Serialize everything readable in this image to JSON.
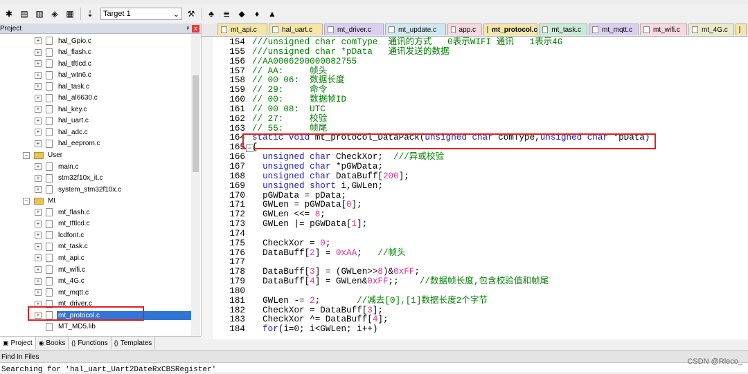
{
  "toolbar": {
    "target_value": "Target 1",
    "icons": [
      "compile-icon",
      "build-icon",
      "rebuild-icon",
      "batch-build-icon",
      "stop-build-icon",
      "load-icon",
      "target-select",
      "options-icon",
      "manage-components-icon",
      "run-time-env-icon",
      "pack-installer-icon",
      "select-packs-icon"
    ]
  },
  "project": {
    "title": "Project",
    "pin": "ᵖ",
    "close": "x",
    "tree": [
      {
        "label": "hal_Gpio.c",
        "type": "file",
        "expander": "+",
        "indent": 1
      },
      {
        "label": "hal_flash.c",
        "type": "file",
        "expander": "+",
        "indent": 1
      },
      {
        "label": "hal_tftlcd.c",
        "type": "file",
        "expander": "+",
        "indent": 1
      },
      {
        "label": "hal_wtn6.c",
        "type": "file",
        "expander": "+",
        "indent": 1
      },
      {
        "label": "hal_task.c",
        "type": "file",
        "expander": "+",
        "indent": 1
      },
      {
        "label": "hal_al6630.c",
        "type": "file",
        "expander": "+",
        "indent": 1
      },
      {
        "label": "hal_key.c",
        "type": "file",
        "expander": "+",
        "indent": 1
      },
      {
        "label": "hal_uart.c",
        "type": "file",
        "expander": "+",
        "indent": 1
      },
      {
        "label": "hal_adc.c",
        "type": "file",
        "expander": "+",
        "indent": 1
      },
      {
        "label": "hal_eeprom.c",
        "type": "file",
        "expander": "+",
        "indent": 1
      },
      {
        "label": "User",
        "type": "folder",
        "expander": "−",
        "indent": 0
      },
      {
        "label": "main.c",
        "type": "file",
        "expander": "+",
        "indent": 1
      },
      {
        "label": "stm32f10x_it.c",
        "type": "file",
        "expander": "+",
        "indent": 1
      },
      {
        "label": "system_stm32f10x.c",
        "type": "file",
        "expander": "+",
        "indent": 1
      },
      {
        "label": "Mt",
        "type": "folder",
        "expander": "−",
        "indent": 0
      },
      {
        "label": "mt_flash.c",
        "type": "file",
        "expander": "+",
        "indent": 1
      },
      {
        "label": "mt_tftlcd.c",
        "type": "file",
        "expander": "+",
        "indent": 1
      },
      {
        "label": "lcdfont.c",
        "type": "file",
        "expander": "+",
        "indent": 1
      },
      {
        "label": "mt_task.c",
        "type": "file",
        "expander": "+",
        "indent": 1
      },
      {
        "label": "mt_api.c",
        "type": "file",
        "expander": "+",
        "indent": 1
      },
      {
        "label": "mt_wifi.c",
        "type": "file",
        "expander": "+",
        "indent": 1
      },
      {
        "label": "mt_4G.c",
        "type": "file",
        "expander": "+",
        "indent": 1
      },
      {
        "label": "mt_mqtt.c",
        "type": "file",
        "expander": "+",
        "indent": 1
      },
      {
        "label": "mt_driver.c",
        "type": "file",
        "expander": "+",
        "indent": 1
      },
      {
        "label": "mt_protocol.c",
        "type": "file",
        "expander": "+",
        "indent": 1,
        "selected": true
      },
      {
        "label": "MT_MD5.lib",
        "type": "file",
        "expander": "",
        "indent": 1
      }
    ],
    "tabs": [
      {
        "label": "Project",
        "icon": "project-tab-icon"
      },
      {
        "label": "Books",
        "icon": "books-tab-icon"
      },
      {
        "label": "Functions",
        "icon": "functions-tab-icon"
      },
      {
        "label": "Templates",
        "icon": "templates-tab-icon"
      }
    ]
  },
  "editor": {
    "tabs": [
      {
        "label": "mt_api.c",
        "color": "#f5e6a8"
      },
      {
        "label": "hal_uart.c",
        "color": "#f5e6a8"
      },
      {
        "label": "mt_driver.c",
        "color": "#d8d0f0"
      },
      {
        "label": "mt_update.c",
        "color": "#d0e8f0"
      },
      {
        "label": "app.c",
        "color": "#f8d8e0"
      },
      {
        "label": "mt_protocol.c",
        "color": "#f5e6a8",
        "active": true
      },
      {
        "label": "mt_task.c",
        "color": "#c8ead8"
      },
      {
        "label": "mt_mqtt.c",
        "color": "#d8d0f0"
      },
      {
        "label": "mt_wifi.c",
        "color": "#f8d8e0"
      },
      {
        "label": "mt_4G.c",
        "color": "#e8ecc8"
      },
      {
        "label": "",
        "color": "#f5e6a8"
      }
    ],
    "lines": [
      {
        "n": "154",
        "code": "///unsigned char comType  通讯的方式   0表示WIFI 通讯   1表示4G"
      },
      {
        "n": "155",
        "code": "///unsigned char *pData   通讯发送的数据"
      },
      {
        "n": "156",
        "code": "//AA0006290000082755"
      },
      {
        "n": "157",
        "code": "// AA:     帧头"
      },
      {
        "n": "158",
        "code": "// 00 06:  数据长度"
      },
      {
        "n": "159",
        "code": "// 29:     命令"
      },
      {
        "n": "160",
        "code": "// 00:     数据帧ID"
      },
      {
        "n": "161",
        "code": "// 00 08:  UTC"
      },
      {
        "n": "162",
        "code": "// 27:     校验"
      },
      {
        "n": "163",
        "code": "// 55:     帧尾"
      },
      {
        "n": "164",
        "code": "static void mt_protocol_DataPack(unsigned char comType,unsigned char *pData)"
      },
      {
        "n": "165",
        "code": "{"
      },
      {
        "n": "166",
        "code": "  unsigned char CheckXor;  ///异或校验"
      },
      {
        "n": "167",
        "code": "  unsigned char *pGWData;"
      },
      {
        "n": "168",
        "code": "  unsigned char DataBuff[200];"
      },
      {
        "n": "169",
        "code": "  unsigned short i,GWLen;"
      },
      {
        "n": "170",
        "code": "  pGWData = pData;"
      },
      {
        "n": "171",
        "code": "  GWLen = pGWData[0];"
      },
      {
        "n": "172",
        "code": "  GWLen <<= 8;"
      },
      {
        "n": "173",
        "code": "  GWLen |= pGWData[1];"
      },
      {
        "n": "174",
        "code": ""
      },
      {
        "n": "175",
        "code": "  CheckXor = 0;"
      },
      {
        "n": "176",
        "code": "  DataBuff[2] = 0xAA;   //帧头"
      },
      {
        "n": "177",
        "code": ""
      },
      {
        "n": "178",
        "code": "  DataBuff[3] = (GWLen>>8)&0xFF;"
      },
      {
        "n": "179",
        "code": "  DataBuff[4] = GWLen&0xFF;;    //数据帧长度,包含校验值和帧尾"
      },
      {
        "n": "180",
        "code": ""
      },
      {
        "n": "181",
        "code": "  GWLen -= 2;       //减去[0],[1]数据长度2个字节"
      },
      {
        "n": "182",
        "code": "  CheckXor = DataBuff[3];"
      },
      {
        "n": "183",
        "code": "  CheckXor ^= DataBuff[4];"
      },
      {
        "n": "184",
        "code": "  for(i=0; i<GWLen; i++)"
      }
    ]
  },
  "bottom": {
    "title": "Find In Files",
    "text": "Searching for 'hal_uart_Uart2DateRxCBSRegister'",
    "watermark": "CSDN @Rleco_"
  }
}
